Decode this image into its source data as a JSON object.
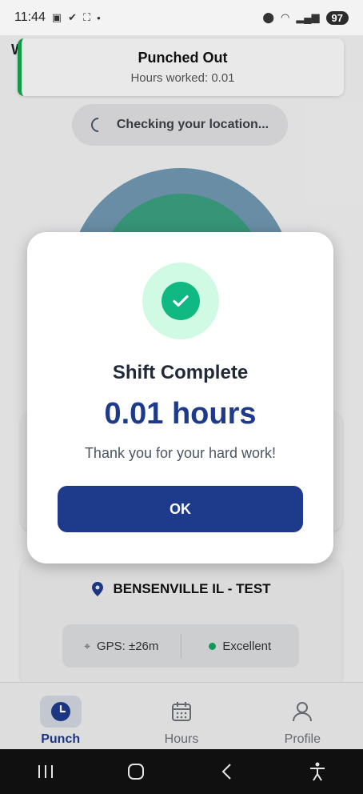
{
  "status_bar": {
    "time": "11:44",
    "battery": "97"
  },
  "background": {
    "header_letter": "W",
    "toast": {
      "title": "Punched Out",
      "subtitle": "Hours worked: 0.01"
    },
    "location_check": "Checking your location...",
    "site_name": "BENSENVILLE IL - TEST",
    "gps_accuracy": "GPS: ±26m",
    "gps_quality": "Excellent"
  },
  "bottom_nav": {
    "items": [
      {
        "label": "Punch",
        "icon": "clock-icon",
        "active": true
      },
      {
        "label": "Hours",
        "icon": "calendar-icon",
        "active": false
      },
      {
        "label": "Profile",
        "icon": "user-icon",
        "active": false
      }
    ]
  },
  "modal": {
    "title": "Shift Complete",
    "hours": "0.01 hours",
    "message": "Thank you for your hard work!",
    "ok_label": "OK"
  },
  "colors": {
    "primary": "#1e3a8a",
    "success": "#10b981",
    "success_light": "#d1fae5"
  }
}
